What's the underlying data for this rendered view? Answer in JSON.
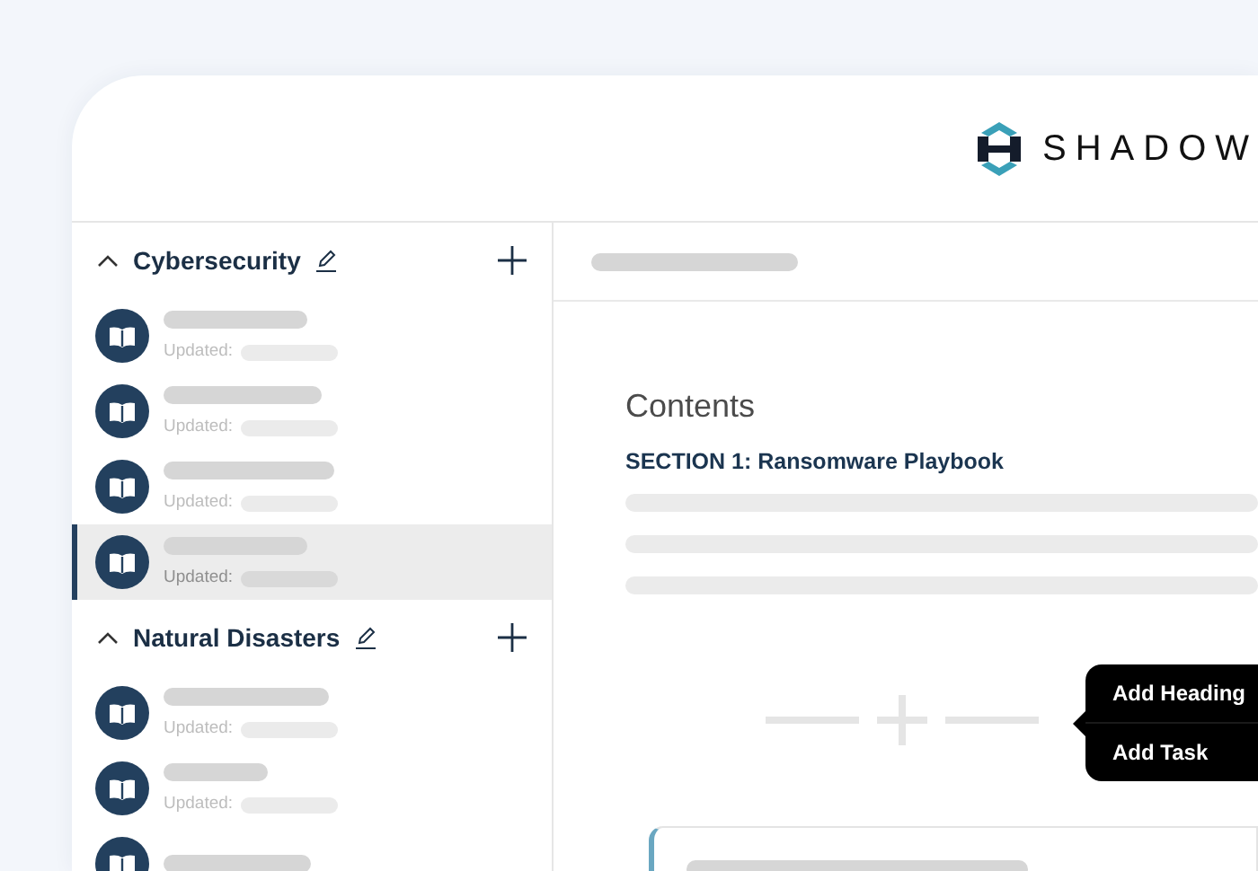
{
  "logo": {
    "text": "SHADOW"
  },
  "sidebar": {
    "groups": [
      {
        "title": "Cybersecurity",
        "expanded": true,
        "items": [
          {
            "updated_label": "Updated:",
            "selected": false
          },
          {
            "updated_label": "Updated:",
            "selected": false
          },
          {
            "updated_label": "Updated:",
            "selected": false
          },
          {
            "updated_label": "Updated:",
            "selected": true
          }
        ]
      },
      {
        "title": "Natural Disasters",
        "expanded": true,
        "items": [
          {
            "updated_label": "Updated:",
            "selected": false
          },
          {
            "updated_label": "Updated:",
            "selected": false
          },
          {
            "selected": false
          }
        ]
      }
    ]
  },
  "main": {
    "heading": "Contents",
    "section_title": "SECTION 1: Ransomware Playbook",
    "add_menu": {
      "items": [
        {
          "label": "Add Heading"
        },
        {
          "label": "Add Task"
        }
      ]
    }
  }
}
